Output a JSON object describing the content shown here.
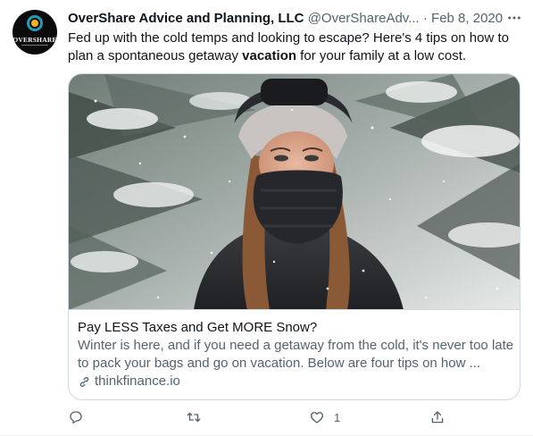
{
  "tweet": {
    "author_name": "OverShare Advice and Planning, LLC",
    "handle": "@OverShareAdv...",
    "separator": "·",
    "date": "Feb 8, 2020",
    "avatar_text": "OVERSHARE",
    "text_before": "Fed up with the cold temps and looking to escape? Here's 4 tips on how to plan a spontaneous getaway ",
    "text_bold": "vacation",
    "text_after": " for your family at a low cost."
  },
  "card": {
    "title": "Pay LESS Taxes and Get MORE Snow?",
    "description": "Winter is here, and if you need a getaway from the cold, it's never too late to pack your bags and go on vacation. Below are four tips on how ...",
    "domain": "thinkfinance.io"
  },
  "actions": {
    "reply_count": "",
    "retweet_count": "",
    "like_count": "1"
  },
  "icons": {
    "more": "more-icon",
    "reply": "reply-icon",
    "retweet": "retweet-icon",
    "like": "like-icon",
    "share": "share-icon",
    "link": "link-icon"
  },
  "colors": {
    "text": "#0f1419",
    "muted": "#536471",
    "border": "#cfd9de",
    "avatar_bg": "#0b0b0b",
    "avatar_ring": "#1f9bb4"
  }
}
